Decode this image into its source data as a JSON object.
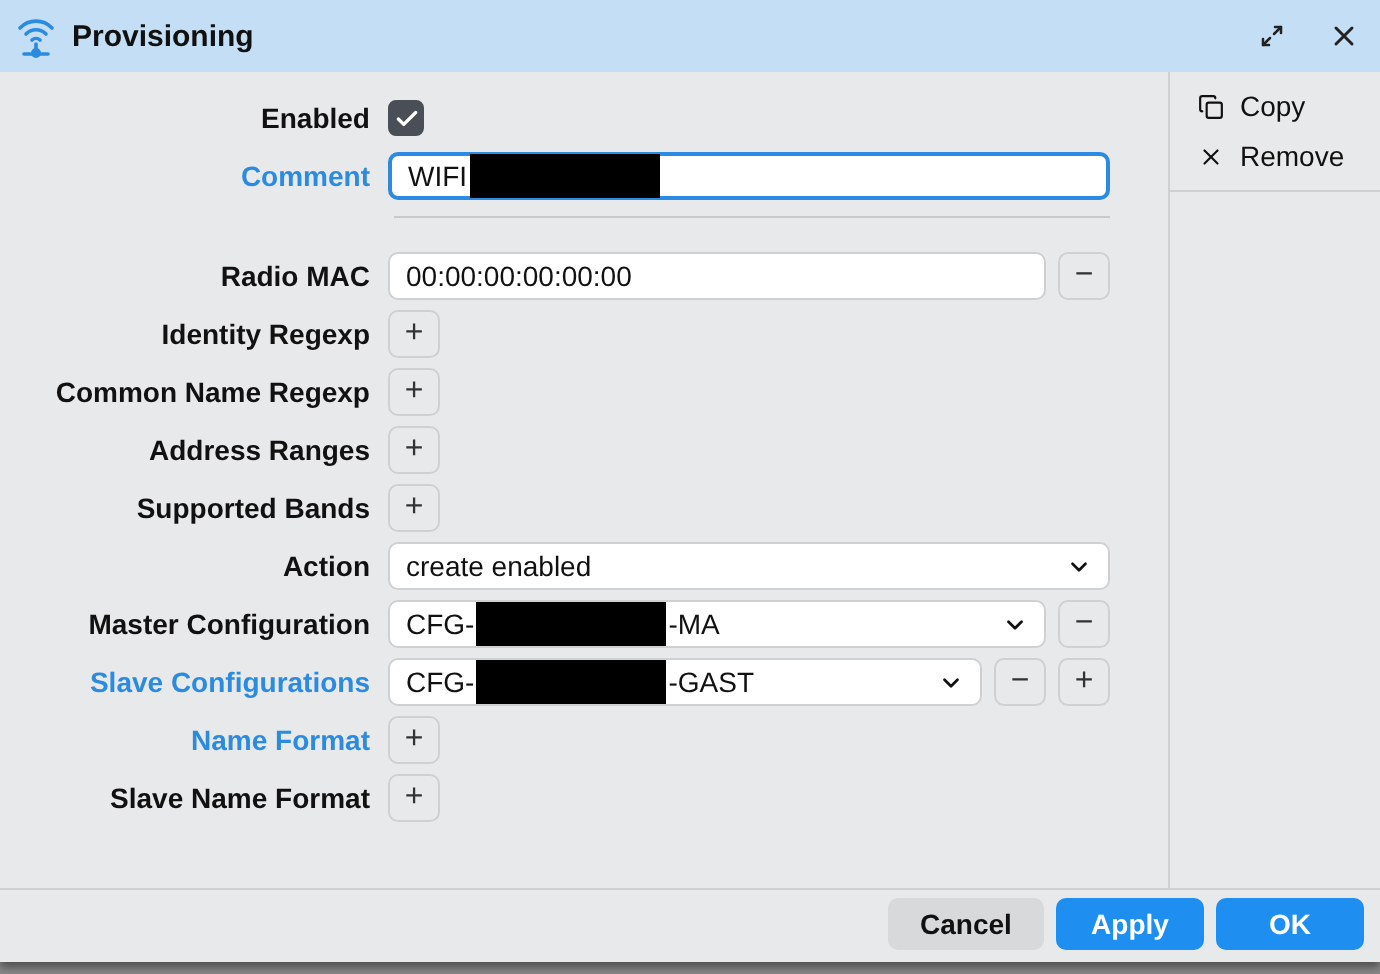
{
  "window": {
    "title": "Provisioning"
  },
  "form": [
    {
      "kind": "checkbox",
      "label": "Enabled",
      "highlight": false,
      "checked": true
    },
    {
      "kind": "text",
      "label": "Comment",
      "highlight": true,
      "focused": true,
      "prefix": "WIFI",
      "redacted": true
    },
    {
      "kind": "divider"
    },
    {
      "kind": "text",
      "label": "Radio MAC",
      "highlight": false,
      "focused": false,
      "prefix": "00:00:00:00:00:00",
      "buttons": [
        "−"
      ]
    },
    {
      "kind": "add",
      "label": "Identity Regexp",
      "highlight": false,
      "buttons": [
        "+"
      ]
    },
    {
      "kind": "add",
      "label": "Common Name Regexp",
      "highlight": false,
      "buttons": [
        "+"
      ]
    },
    {
      "kind": "add",
      "label": "Address Ranges",
      "highlight": false,
      "buttons": [
        "+"
      ]
    },
    {
      "kind": "add",
      "label": "Supported Bands",
      "highlight": false,
      "buttons": [
        "+"
      ]
    },
    {
      "kind": "select",
      "label": "Action",
      "highlight": false,
      "prefix": "create enabled"
    },
    {
      "kind": "select",
      "label": "Master Configuration",
      "highlight": false,
      "prefix": "CFG-",
      "redacted": true,
      "suffix": "-MA",
      "buttons": [
        "−"
      ]
    },
    {
      "kind": "select",
      "label": "Slave Configurations",
      "highlight": true,
      "prefix": "CFG-",
      "redacted": true,
      "suffix": "-GAST",
      "buttons": [
        "−",
        "+"
      ]
    },
    {
      "kind": "add",
      "label": "Name Format",
      "highlight": true,
      "buttons": [
        "+"
      ]
    },
    {
      "kind": "add",
      "label": "Slave Name Format",
      "highlight": false,
      "buttons": [
        "+"
      ]
    }
  ],
  "sidebar": [
    {
      "kind": "copy",
      "label": "Copy"
    },
    {
      "kind": "remove",
      "label": "Remove"
    }
  ],
  "footer_buttons": [
    {
      "label": "Cancel",
      "primary": false
    },
    {
      "label": "Apply",
      "primary": true
    },
    {
      "label": "OK",
      "primary": true
    }
  ]
}
